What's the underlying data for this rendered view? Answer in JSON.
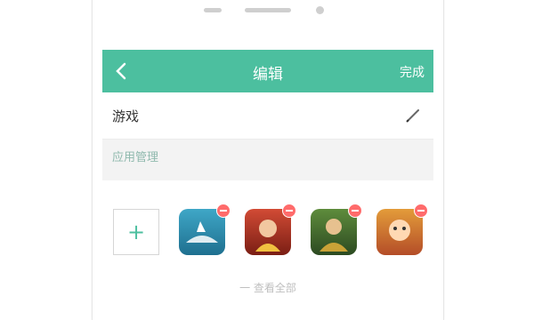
{
  "header": {
    "title": "编辑",
    "done_label": "完成",
    "accent_color": "#4cbf9f"
  },
  "folder": {
    "name": "游戏"
  },
  "apps_section": {
    "header": "应用管理",
    "apps": [
      {
        "icon": "shark-game-app-icon"
      },
      {
        "icon": "three-kingdoms-game-app-icon"
      },
      {
        "icon": "strategy-game-app-icon"
      },
      {
        "icon": "cartoon-game-app-icon"
      }
    ]
  },
  "bottom_hint": "一 查看全部"
}
